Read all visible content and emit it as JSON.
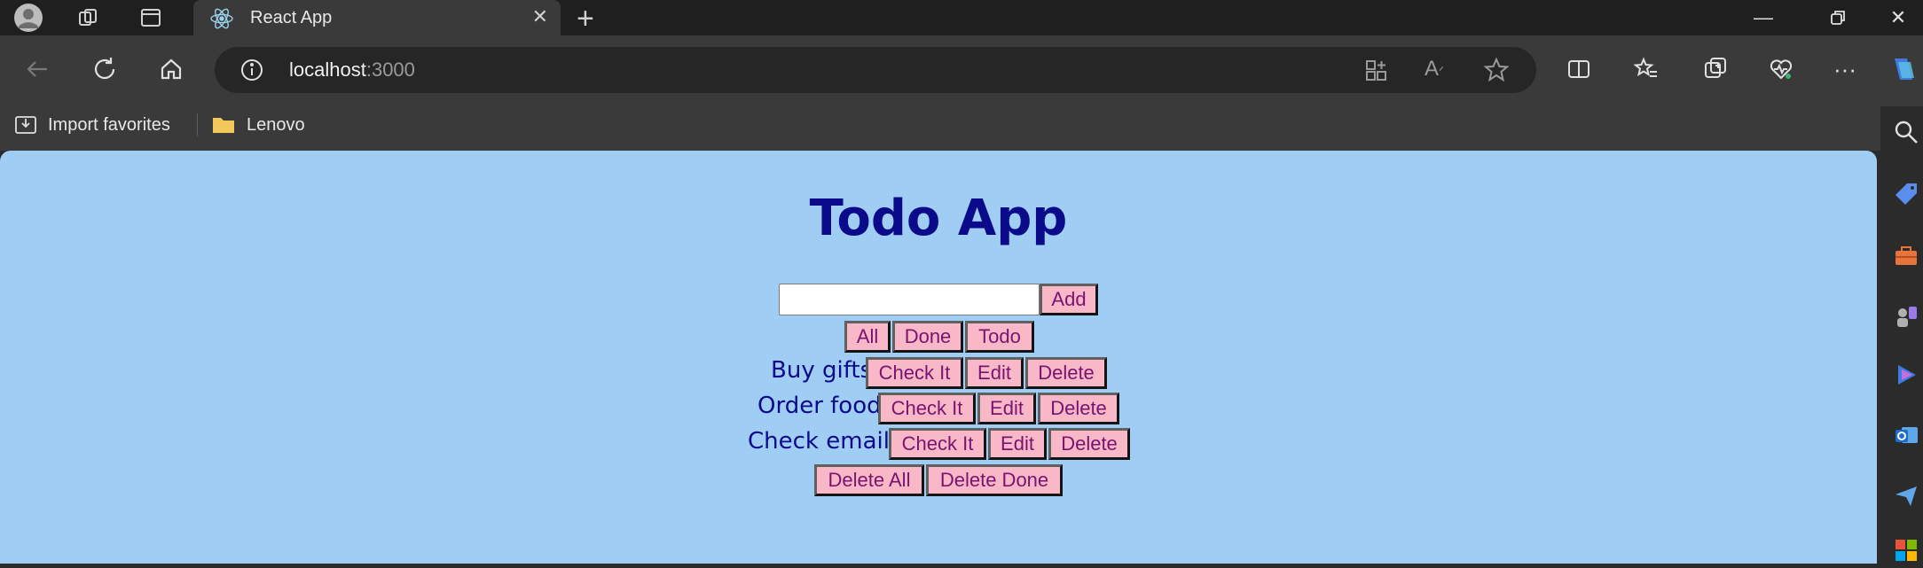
{
  "browser": {
    "tab_title": "React App",
    "url_host": "localhost",
    "url_port": ":3000",
    "bookmarks": [
      "Import favorites",
      "Lenovo"
    ]
  },
  "app": {
    "title": "Todo App",
    "input_value": "",
    "add_label": "Add",
    "filters": [
      "All",
      "Done",
      "Todo"
    ],
    "todos": [
      {
        "text": "Buy gifts",
        "check_label": "Check It",
        "edit_label": "Edit",
        "delete_label": "Delete"
      },
      {
        "text": "Order food",
        "check_label": "Check It",
        "edit_label": "Edit",
        "delete_label": "Delete"
      },
      {
        "text": "Check emails",
        "check_label": "Check It",
        "edit_label": "Edit",
        "delete_label": "Delete"
      }
    ],
    "delete_all_label": "Delete All",
    "delete_done_label": "Delete Done"
  },
  "colors": {
    "page_bg": "#a0cdf4",
    "title": "#0b0a8a",
    "button_bg": "#f8b8c8",
    "button_text": "#7a1370"
  }
}
